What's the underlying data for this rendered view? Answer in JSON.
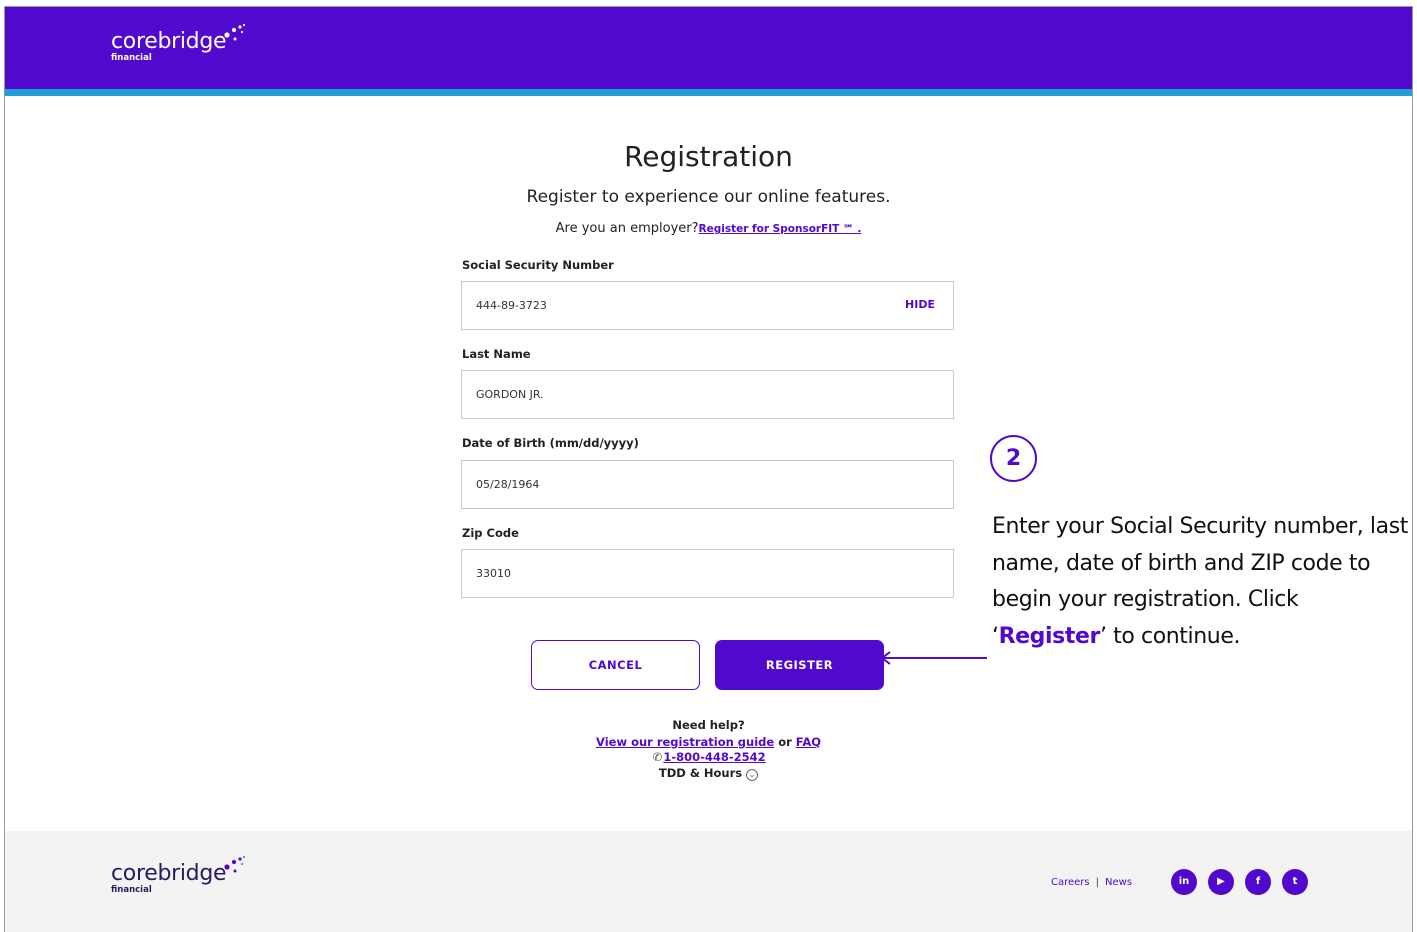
{
  "brand": {
    "name": "corebridge",
    "sub": "financial",
    "colors": {
      "primary": "#5109ce",
      "stripe": "#1f9fd8",
      "footer_bg": "#f3f3f3"
    }
  },
  "page": {
    "title": "Registration",
    "subtitle": "Register to experience our online features.",
    "employer_question": "Are you an employer?",
    "employer_link": "Register for SponsorFIT ℠ ."
  },
  "form": {
    "ssn": {
      "label": "Social Security Number",
      "value": "444-89-3723",
      "toggle_label": "HIDE"
    },
    "last_name": {
      "label": "Last Name",
      "value": "GORDON JR."
    },
    "dob": {
      "label": "Date of Birth (mm/dd/yyyy)",
      "value": "05/28/1964"
    },
    "zip": {
      "label": "Zip Code",
      "value": "33010"
    },
    "cancel_label": "CANCEL",
    "register_label": "REGISTER"
  },
  "help": {
    "heading": "Need help?",
    "guide_link": "View our registration guide",
    "or": "or",
    "faq_link": "FAQ",
    "phone_icon": "phone-icon",
    "phone": "1-800-448-2542",
    "tdd": "TDD & Hours",
    "tdd_icon": "chevron-down-circle-icon"
  },
  "annotation": {
    "step_number": "2",
    "text_before": "Enter your Social Security number, last name, date of birth and ZIP code to begin your registration. Click ‘",
    "highlight": "Register",
    "text_after": "’ to continue."
  },
  "footer": {
    "careers": "Careers",
    "separator": "|",
    "news": "News",
    "social": [
      {
        "icon": "linkedin-icon",
        "glyph": "in"
      },
      {
        "icon": "youtube-icon",
        "glyph": "▶"
      },
      {
        "icon": "facebook-icon",
        "glyph": "f"
      },
      {
        "icon": "twitter-icon",
        "glyph": "t"
      }
    ]
  }
}
